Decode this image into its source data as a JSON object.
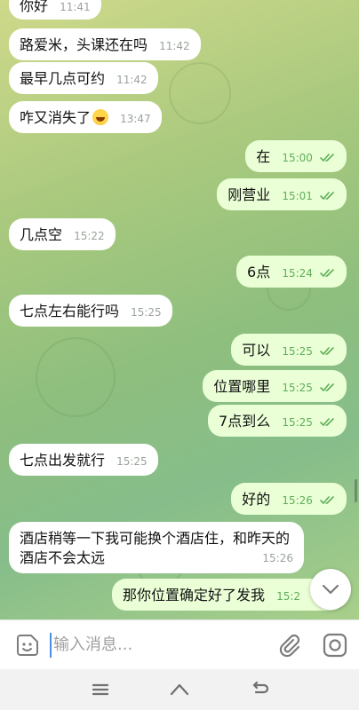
{
  "messages": [
    {
      "dir": "in",
      "text": "你好",
      "time": "11:41"
    },
    {
      "dir": "in",
      "text": "路爱米，头课还在吗",
      "time": "11:42"
    },
    {
      "dir": "in",
      "text": "最早几点可约",
      "time": "11:42"
    },
    {
      "dir": "in",
      "text": "咋又消失了",
      "time": "13:47",
      "emoji": "laughing-emoji"
    },
    {
      "dir": "out",
      "text": "在",
      "time": "15:00"
    },
    {
      "dir": "out",
      "text": "刚营业",
      "time": "15:01"
    },
    {
      "dir": "in",
      "text": "几点空",
      "time": "15:22"
    },
    {
      "dir": "out",
      "text": "6点",
      "time": "15:24"
    },
    {
      "dir": "in",
      "text": "七点左右能行吗",
      "time": "15:25"
    },
    {
      "dir": "out",
      "text": "可以",
      "time": "15:25"
    },
    {
      "dir": "out",
      "text": "位置哪里",
      "time": "15:25"
    },
    {
      "dir": "out",
      "text": "7点到么",
      "time": "15:25"
    },
    {
      "dir": "in",
      "text": "七点出发就行",
      "time": "15:25"
    },
    {
      "dir": "out",
      "text": "好的",
      "time": "15:26"
    },
    {
      "dir": "in",
      "text": "酒店稍等一下我可能换个酒店住，和昨天的酒店不会太远",
      "time": "15:26"
    },
    {
      "dir": "out",
      "text": "那你位置确定好了发我",
      "time": "15:2"
    }
  ],
  "input": {
    "placeholder": "输入消息..."
  },
  "icons": {
    "emoji": "sticker-emoji-icon",
    "attach": "paperclip-icon",
    "camera": "camera-icon",
    "scroll": "chevron-down-icon",
    "read": "double-check-icon",
    "nav_menu": "menu-icon",
    "nav_home": "home-icon",
    "nav_back": "back-icon"
  },
  "colors": {
    "incoming_bubble": "#ffffff",
    "outgoing_bubble": "#eaffd6",
    "read_check": "#5fae5a",
    "cursor": "#4a90e2"
  }
}
